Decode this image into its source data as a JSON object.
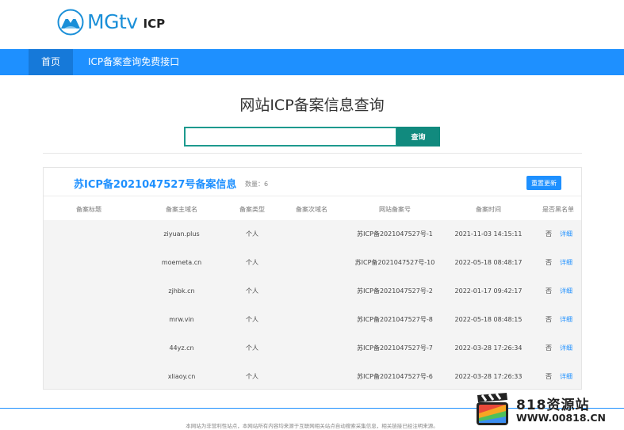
{
  "header": {
    "logo_text": "MGtv",
    "logo_suffix": "ICP"
  },
  "nav": {
    "home": "首页",
    "api": "ICP备案查询免费接口"
  },
  "main": {
    "title": "网站ICP备案信息查询",
    "search_value": "",
    "search_button": "查询"
  },
  "card": {
    "title": "苏ICP备2021047527号备案信息",
    "count": "数量：6",
    "refresh": "重置更新",
    "columns": [
      "备案标题",
      "备案主域名",
      "备案类型",
      "备案次域名",
      "网站备案号",
      "备案时间",
      "是否黑名单"
    ],
    "rows": [
      {
        "title": "",
        "domain": "ziyuan.plus",
        "type": "个人",
        "sub": "",
        "icp": "苏ICP备2021047527号-1",
        "time": "2021-11-03 14:15:11",
        "black": "否",
        "detail": "详细"
      },
      {
        "title": "",
        "domain": "moemeta.cn",
        "type": "个人",
        "sub": "",
        "icp": "苏ICP备2021047527号-10",
        "time": "2022-05-18 08:48:17",
        "black": "否",
        "detail": "详细"
      },
      {
        "title": "",
        "domain": "zjhbk.cn",
        "type": "个人",
        "sub": "",
        "icp": "苏ICP备2021047527号-2",
        "time": "2022-01-17 09:42:17",
        "black": "否",
        "detail": "详细"
      },
      {
        "title": "",
        "domain": "mrw.vin",
        "type": "个人",
        "sub": "",
        "icp": "苏ICP备2021047527号-8",
        "time": "2022-05-18 08:48:15",
        "black": "否",
        "detail": "详细"
      },
      {
        "title": "",
        "domain": "44yz.cn",
        "type": "个人",
        "sub": "",
        "icp": "苏ICP备2021047527号-7",
        "time": "2022-03-28 17:26:34",
        "black": "否",
        "detail": "详细"
      },
      {
        "title": "",
        "domain": "xliaoy.cn",
        "type": "个人",
        "sub": "",
        "icp": "苏ICP备2021047527号-6",
        "time": "2022-03-28 17:26:33",
        "black": "否",
        "detail": "详细"
      }
    ]
  },
  "footer": {
    "text": "本网站为非营利性站点，本网站所有内容均来源于互联网相关站点自动搜索采集信息，相关链接已经注明来源。"
  },
  "watermark": {
    "title": "818资源站",
    "url": "WWW.00818.CN"
  },
  "colors": {
    "brand": "#1e90ff",
    "nav_active": "#1679d9",
    "search_teal": "#118a7e"
  }
}
